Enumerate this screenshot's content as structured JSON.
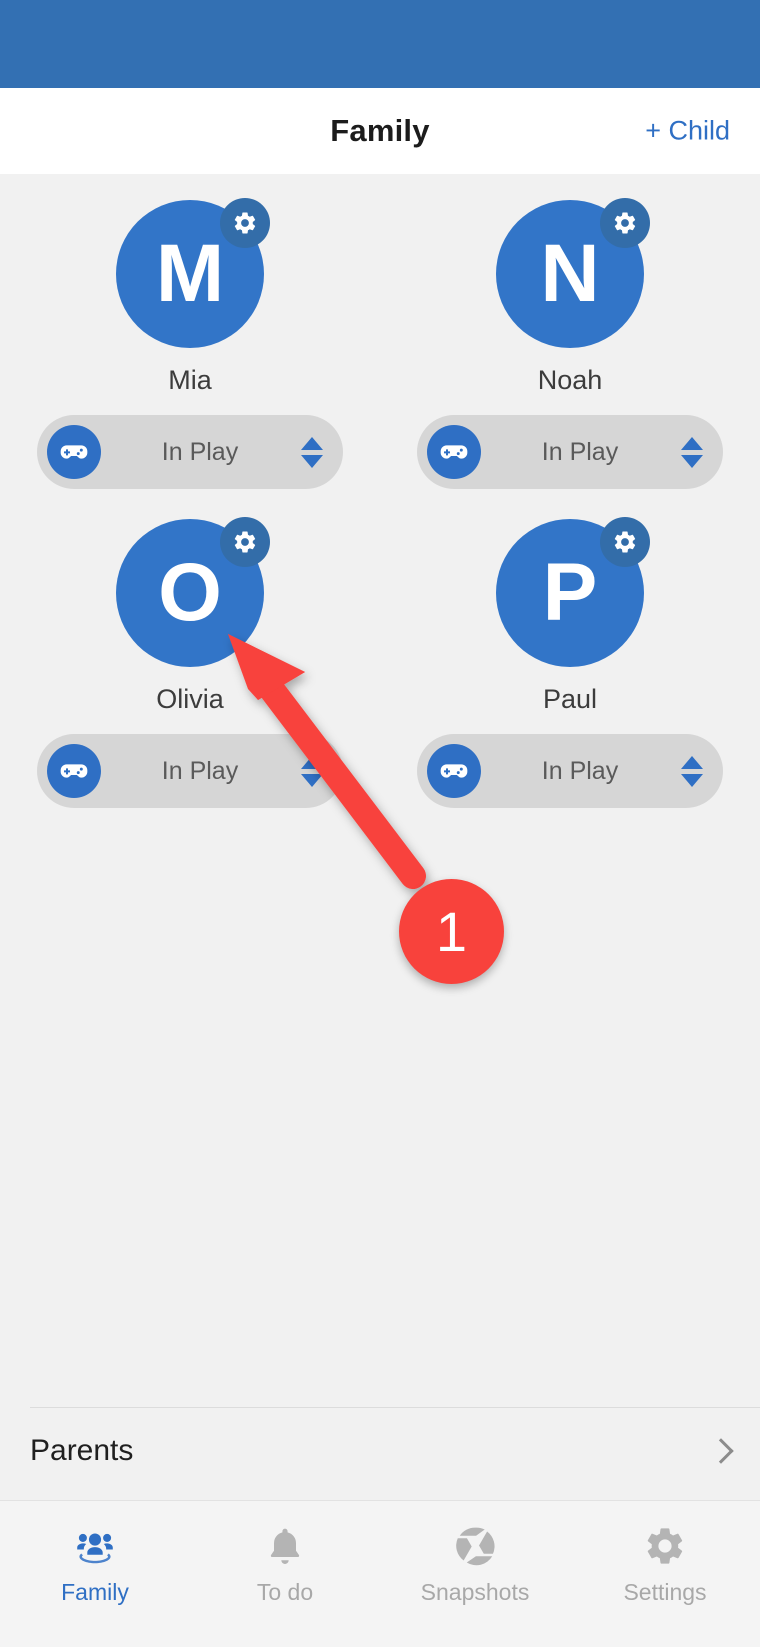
{
  "header": {
    "title": "Family",
    "action_label": "+ Child"
  },
  "children": [
    {
      "initial": "M",
      "name": "Mia",
      "status": "In Play",
      "status_icon": "gamepad-icon",
      "settings_icon": "gear-icon"
    },
    {
      "initial": "N",
      "name": "Noah",
      "status": "In Play",
      "status_icon": "gamepad-icon",
      "settings_icon": "gear-icon"
    },
    {
      "initial": "O",
      "name": "Olivia",
      "status": "In Play",
      "status_icon": "gamepad-icon",
      "settings_icon": "gear-icon"
    },
    {
      "initial": "P",
      "name": "Paul",
      "status": "In Play",
      "status_icon": "gamepad-icon",
      "settings_icon": "gear-icon"
    }
  ],
  "parents_row": {
    "label": "Parents",
    "icon": "chevron-right-icon"
  },
  "tab_bar": {
    "tabs": [
      {
        "label": "Family",
        "icon": "people-group-icon",
        "active": true
      },
      {
        "label": "To do",
        "icon": "bell-icon",
        "active": false
      },
      {
        "label": "Snapshots",
        "icon": "aperture-icon",
        "active": false
      },
      {
        "label": "Settings",
        "icon": "gear-icon",
        "active": false
      }
    ]
  },
  "annotation": {
    "step_number": "1",
    "arrow_icon": "arrow-pointer-icon",
    "target": "Olivia avatar"
  },
  "colors": {
    "status_bar": "#3370b3",
    "accent_blue": "#2f6fc4",
    "avatar_blue": "#3275c8",
    "gear_badge_blue": "#336da9",
    "pill_gray": "#d6d6d6",
    "page_background": "#f1f1f1",
    "annotation_red": "#f8423c"
  }
}
